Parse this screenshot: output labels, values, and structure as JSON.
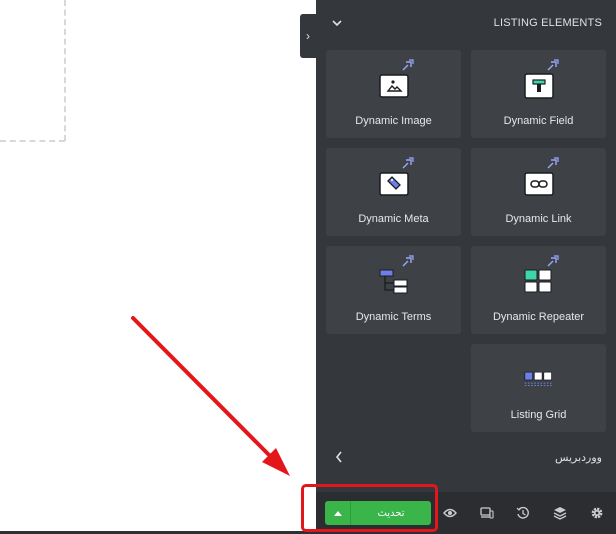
{
  "panel": {
    "section_title": "LISTING ELEMENTS",
    "widgets": [
      {
        "label": "Dynamic Image",
        "icon": "image-icon"
      },
      {
        "label": "Dynamic Field",
        "icon": "text-field-icon"
      },
      {
        "label": "Dynamic Meta",
        "icon": "tag-icon"
      },
      {
        "label": "Dynamic Link",
        "icon": "link-icon"
      },
      {
        "label": "Dynamic Terms",
        "icon": "terms-tree-icon"
      },
      {
        "label": "Dynamic Repeater",
        "icon": "repeater-icon"
      },
      {
        "label": "Listing Grid",
        "icon": "grid-icon"
      }
    ],
    "site_name": "ووردبريس"
  },
  "toolbar": {
    "publish_label": "تحديث"
  },
  "colors": {
    "panel_bg": "#34373c",
    "card_bg": "#3e4246",
    "publish_green": "#39b54a",
    "highlight_red": "#e3161b",
    "accent_teal": "#3ed6a8",
    "accent_blue": "#6d7ee8"
  }
}
